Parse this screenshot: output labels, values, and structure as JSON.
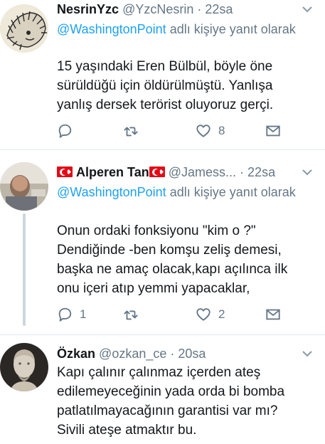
{
  "tweets": [
    {
      "name": "NesrinYzc",
      "handle": "@YzcNesrin",
      "separator": "·",
      "time": "22sa",
      "reply_mention": "@WashingtonPoint",
      "reply_suffix": " adlı kişiye yanıt olarak",
      "text": "15 yaşındaki Eren Bülbül, böyle öne sürüldüğü için öldürülmüştü. Yanlışa yanlış dersek terörist oluyoruz gerçi.",
      "reply_count": "",
      "retweet_count": "",
      "like_count": "8"
    },
    {
      "name": "Alperen Tan",
      "handle": "@Jamess...",
      "separator": "·",
      "time": "22sa",
      "reply_mention": "@WashingtonPoint",
      "reply_suffix": " adlı kişiye yanıt olarak",
      "text": "Onun ordaki fonksiyonu \"kim o ?\" Dendiğinde -ben komşu zeliş demesi, başka ne amaç olacak,kapı açılınca ilk onu içeri atıp yemmi yapacaklar,",
      "reply_count": "1",
      "retweet_count": "",
      "like_count": "2"
    },
    {
      "name": "Özkan",
      "handle": "@ozkan_ce",
      "separator": "·",
      "time": "20sa",
      "text": "Kapı çalınır çalınmaz içerden ateş edilemeyeceğinin yada orda bi bomba patlatılmayacağının garantisi var mı? Sivili ateşe atmaktır bu."
    }
  ],
  "icons": {
    "reply": "reply-icon",
    "retweet": "retweet-icon",
    "like": "heart-icon",
    "dm": "envelope-icon",
    "caret": "chevron-down-icon"
  },
  "colors": {
    "link": "#1da1f2",
    "muted": "#657786",
    "text": "#14171a",
    "divider": "#e1e8ed",
    "flag": "#e30a17"
  }
}
